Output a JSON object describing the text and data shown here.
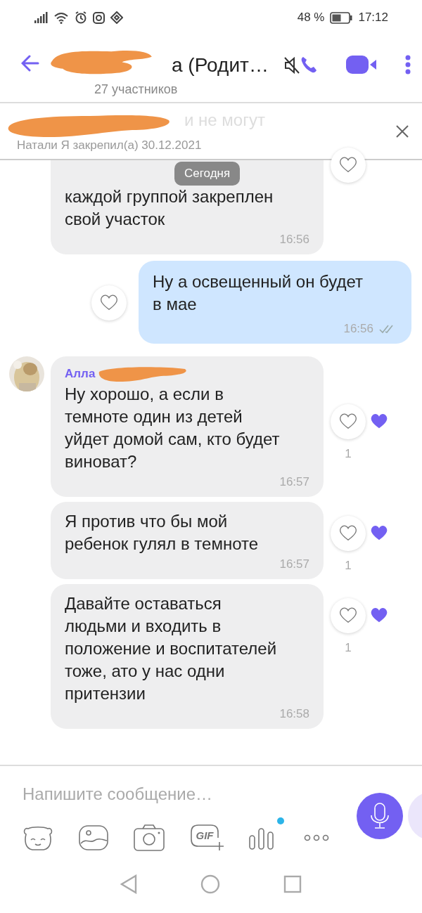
{
  "status_bar": {
    "battery": "48 %",
    "time": "17:12"
  },
  "header": {
    "title": "а (Родит…",
    "subtitle": "27 участников",
    "muted": true
  },
  "pinned": {
    "preview": "и не могут",
    "meta": "Натали Я закрепил(а) 30.12.2021"
  },
  "date_pill": "Сегодня",
  "messages": [
    {
      "kind": "incoming",
      "text": "каждой группой закреплен\nсвой участок",
      "time": "16:56",
      "liked": false
    },
    {
      "kind": "outgoing",
      "text": "Ну а освещенный он будет\nв мае",
      "time": "16:56",
      "liked": false
    },
    {
      "kind": "incoming",
      "sender": "Алла",
      "text": "Ну хорошо, а если в\nтемноте один из детей\nуйдет домой сам, кто будет\nвиноват?",
      "time": "16:57",
      "liked": false,
      "reaction_count": "1"
    },
    {
      "kind": "incoming",
      "text": "Я против что бы мой\nребенок гулял в темноте",
      "time": "16:57",
      "liked": false,
      "reaction_count": "1"
    },
    {
      "kind": "incoming",
      "text": "Давайте оставаться\nлюдьми и входить в\nположение и воспитателей\nтоже, ато у нас одни\nпритензии",
      "time": "16:58",
      "liked": false,
      "reaction_count": "1"
    }
  ],
  "composer": {
    "placeholder": "Напишите сообщение…",
    "gif_label": "GIF",
    "new_badge": true
  }
}
